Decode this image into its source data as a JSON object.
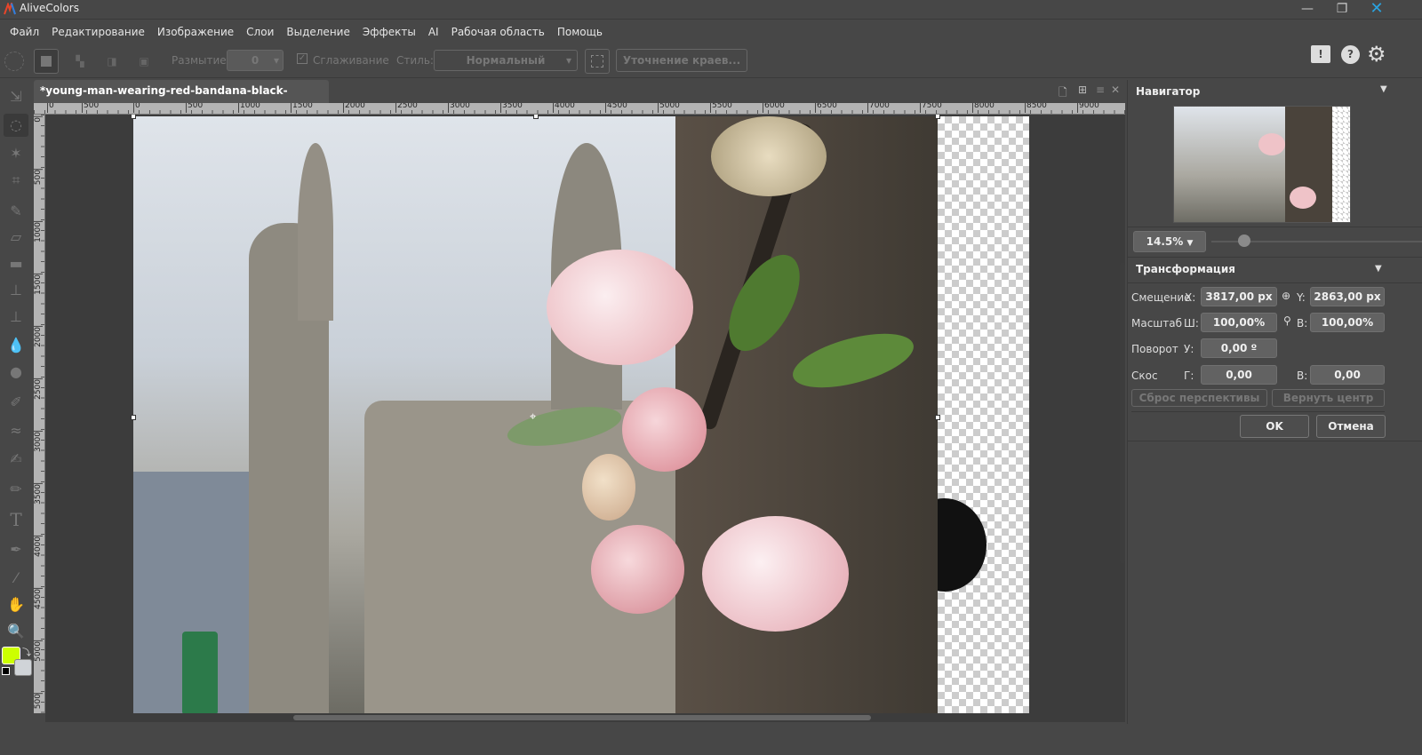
{
  "app": {
    "title": "AliveColors",
    "accent": "#2aa3e0"
  },
  "menu": [
    "Файл",
    "Редактирование",
    "Изображение",
    "Слои",
    "Выделение",
    "Эффекты",
    "AI",
    "Рабочая область",
    "Помощь"
  ],
  "options": {
    "blur_label": "Размытие",
    "blur_value": "0",
    "smooth_label": "Сглаживание",
    "smooth_checked": true,
    "style_label": "Стиль:",
    "style_value": "Нормальный",
    "refine_label": "Уточнение краев..."
  },
  "document": {
    "tab_title": "*young-man-wearing-red-bandana-black-shirt.jpg",
    "close": "×"
  },
  "rulers": {
    "h": [
      "0",
      "500",
      "0",
      "500",
      "1000",
      "1500",
      "2000",
      "2500",
      "3000",
      "3500",
      "4000",
      "4500",
      "5000",
      "5500",
      "6000",
      "6500",
      "7000",
      "7500",
      "8000",
      "8500",
      "9000"
    ],
    "v": [
      "0",
      "500",
      "1000",
      "1500",
      "2000",
      "2500",
      "3000",
      "3500",
      "4000",
      "4500",
      "5000",
      "500"
    ]
  },
  "colors": {
    "foreground": "#ccff00",
    "background": "#d0d4d8"
  },
  "navigator": {
    "title": "Навигатор",
    "zoom": "14.5%",
    "zoom_slider": 0.2
  },
  "transform": {
    "title": "Трансформация",
    "offset_label": "Смещение",
    "x_label": "X:",
    "x_value": "3817,00 px",
    "y_label": "Y:",
    "y_value": "2863,00 px",
    "scale_label": "Масштаб",
    "w_label": "Ш:",
    "w_value": "100,00%",
    "h_label": "В:",
    "h_value": "100,00%",
    "rotate_label": "Поворот",
    "angle_label": "У:",
    "angle_value": "0,00 º",
    "skew_label": "Скос",
    "skew_h_label": "Г:",
    "skew_h_value": "0,00",
    "skew_v_label": "В:",
    "skew_v_value": "0,00",
    "reset_perspective": "Сброс перспективы",
    "restore_center": "Вернуть центр",
    "ok": "OK",
    "cancel": "Отмена"
  }
}
